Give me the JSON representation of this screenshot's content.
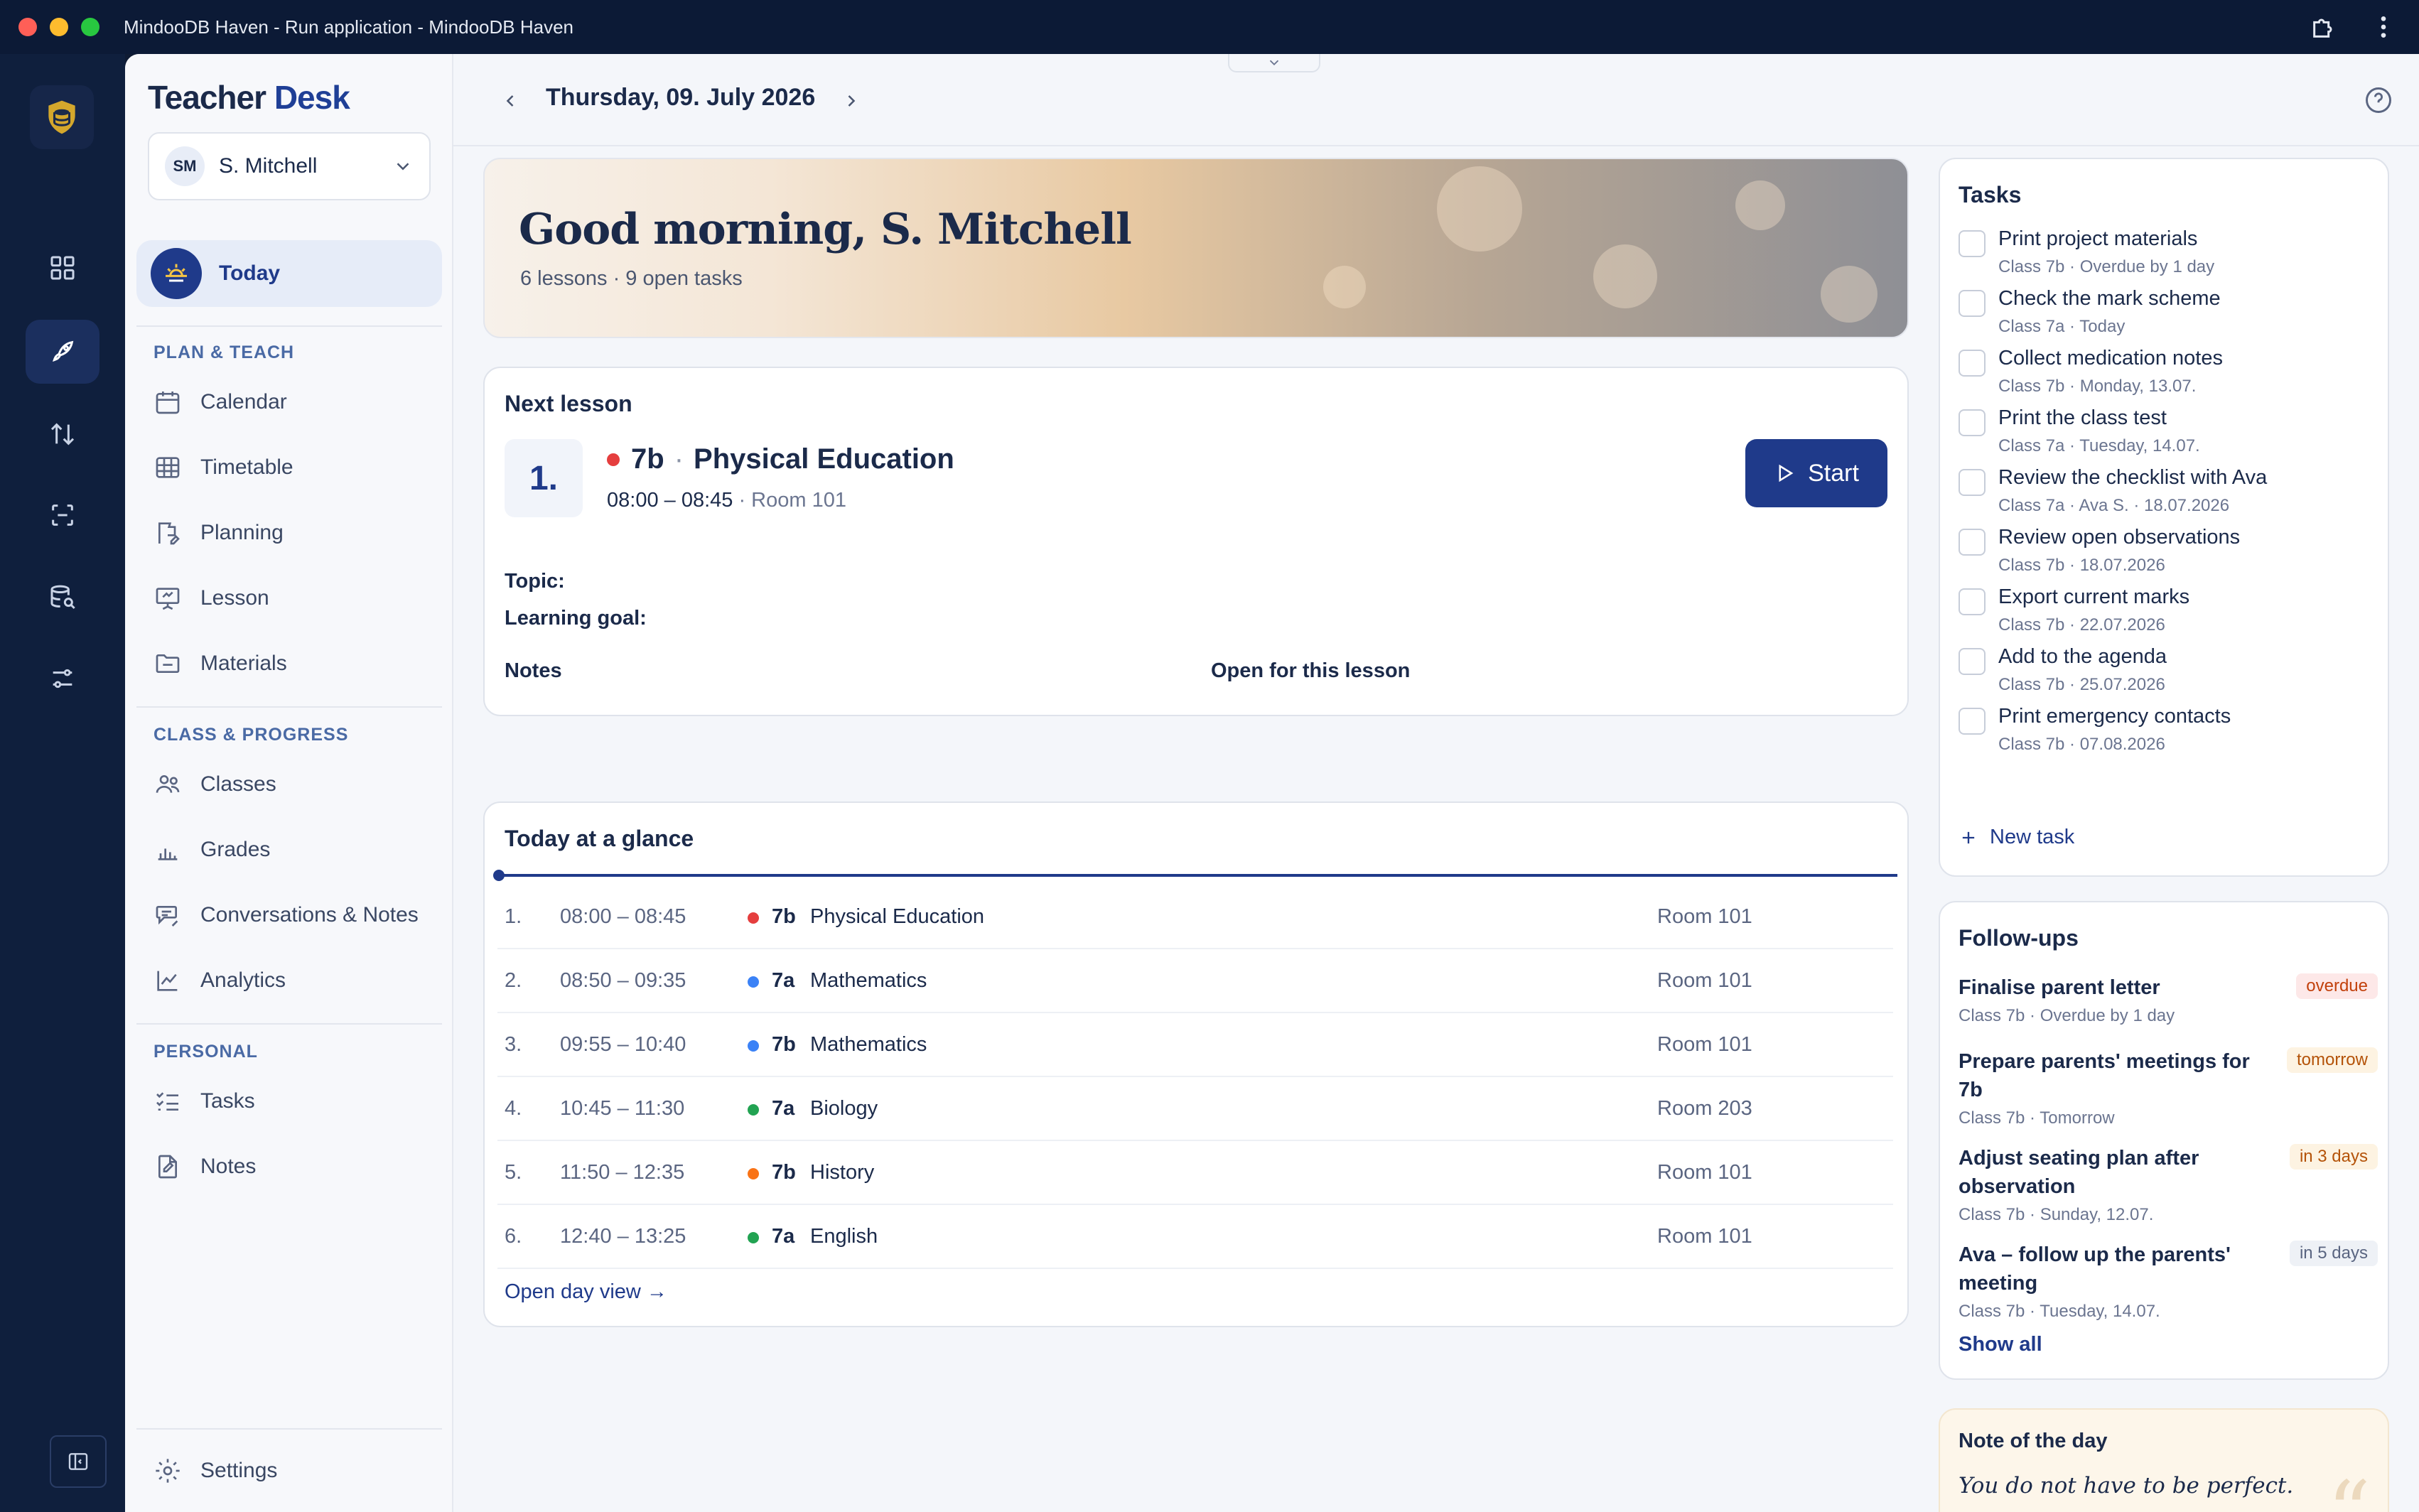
{
  "window": {
    "title": "MindooDB Haven - Run application - MindooDB Haven"
  },
  "sidebar": {
    "brand_1": "Teacher",
    "brand_2": "Desk",
    "user_initials": "SM",
    "user_name": "S. Mitchell",
    "today_label": "Today",
    "sections": {
      "plan": "PLAN & TEACH",
      "class": "CLASS & PROGRESS",
      "personal": "PERSONAL"
    },
    "items": {
      "calendar": "Calendar",
      "timetable": "Timetable",
      "planning": "Planning",
      "lesson": "Lesson",
      "materials": "Materials",
      "classes": "Classes",
      "grades": "Grades",
      "conversations": "Conversations & Notes",
      "analytics": "Analytics",
      "tasks": "Tasks",
      "notes": "Notes",
      "settings": "Settings"
    }
  },
  "topbar": {
    "date": "Thursday, 09. July 2026"
  },
  "hero": {
    "greeting": "Good morning, S. Mitchell",
    "summary": "6 lessons · 9 open tasks"
  },
  "next_lesson": {
    "title": "Next lesson",
    "number": "1.",
    "class": "7b",
    "separator": "·",
    "subject": "Physical Education",
    "time": "08:00 – 08:45",
    "meta_sep": " · ",
    "room": "Room 101",
    "start_label": "Start",
    "topic_label": "Topic:",
    "goal_label": "Learning goal:",
    "notes_label": "Notes",
    "notes_value": "Open for this lesson"
  },
  "glance": {
    "title": "Today at a glance",
    "rows": [
      {
        "n": "1.",
        "time": "08:00 – 08:45",
        "class": "7b",
        "subject": "Physical Education",
        "room": "Room 101",
        "color": "#e53e3e"
      },
      {
        "n": "2.",
        "time": "08:50 – 09:35",
        "class": "7a",
        "subject": "Mathematics",
        "room": "Room 101",
        "color": "#3b82f6"
      },
      {
        "n": "3.",
        "time": "09:55 – 10:40",
        "class": "7b",
        "subject": "Mathematics",
        "room": "Room 101",
        "color": "#3b82f6"
      },
      {
        "n": "4.",
        "time": "10:45 – 11:30",
        "class": "7a",
        "subject": "Biology",
        "room": "Room 203",
        "color": "#22a352"
      },
      {
        "n": "5.",
        "time": "11:50 – 12:35",
        "class": "7b",
        "subject": "History",
        "room": "Room 101",
        "color": "#f97316"
      },
      {
        "n": "6.",
        "time": "12:40 – 13:25",
        "class": "7a",
        "subject": "English",
        "room": "Room 101",
        "color": "#22a352"
      }
    ],
    "open_day": "Open day view →"
  },
  "tasks": {
    "title": "Tasks",
    "items": [
      {
        "title": "Print project materials",
        "sub": "Class 7b · Overdue by 1 day"
      },
      {
        "title": "Check the mark scheme",
        "sub": "Class 7a · Today"
      },
      {
        "title": "Collect medication notes",
        "sub": "Class 7b · Monday, 13.07."
      },
      {
        "title": "Print the class test",
        "sub": "Class 7a · Tuesday, 14.07."
      },
      {
        "title": "Review the checklist with Ava",
        "sub": "Class 7a · Ava S. · 18.07.2026"
      },
      {
        "title": "Review open observations",
        "sub": "Class 7b · 18.07.2026"
      },
      {
        "title": "Export current marks",
        "sub": "Class 7b · 22.07.2026"
      },
      {
        "title": "Add to the agenda",
        "sub": "Class 7b · 25.07.2026"
      },
      {
        "title": "Print emergency contacts",
        "sub": "Class 7b · 07.08.2026"
      }
    ],
    "new_task": "New task"
  },
  "followups": {
    "title": "Follow-ups",
    "items": [
      {
        "title": "Finalise parent letter",
        "sub": "Class 7b · Overdue by 1 day",
        "badge": "overdue"
      },
      {
        "title": "Prepare parents' meetings for 7b",
        "sub": "Class 7b · Tomorrow",
        "badge": "tomorrow"
      },
      {
        "title": "Adjust seating plan after observation",
        "sub": "Class 7b · Sunday, 12.07.",
        "badge": "in 3 days"
      },
      {
        "title": "Ava – follow up the parents' meeting",
        "sub": "Class 7b · Tuesday, 14.07.",
        "badge": "in 5 days"
      }
    ],
    "show_all": "Show all"
  },
  "note_of_day": {
    "title": "Note of the day",
    "text": "You do not have to be perfect. Present and kind is more than enough."
  }
}
